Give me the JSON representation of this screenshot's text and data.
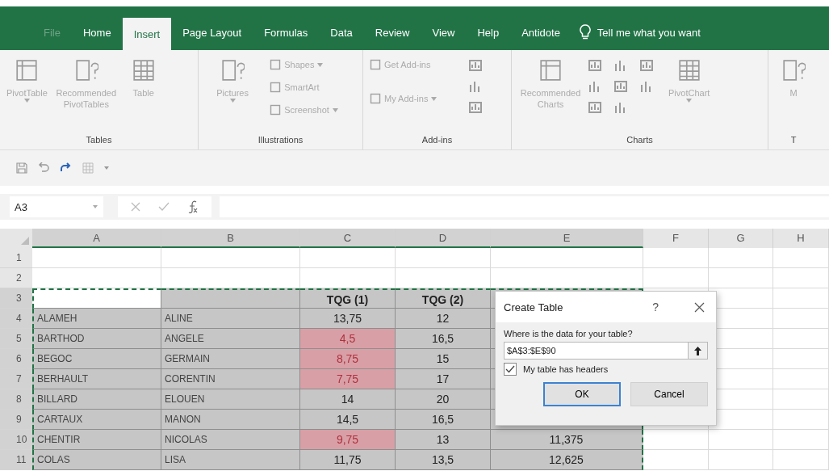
{
  "tabs": [
    {
      "label": "File",
      "selected": false,
      "disabled": true
    },
    {
      "label": "Home",
      "selected": false,
      "disabled": false
    },
    {
      "label": "Insert",
      "selected": true,
      "disabled": false
    },
    {
      "label": "Page Layout",
      "selected": false,
      "disabled": false
    },
    {
      "label": "Formulas",
      "selected": false,
      "disabled": false
    },
    {
      "label": "Data",
      "selected": false,
      "disabled": false
    },
    {
      "label": "Review",
      "selected": false,
      "disabled": false
    },
    {
      "label": "View",
      "selected": false,
      "disabled": false
    },
    {
      "label": "Help",
      "selected": false,
      "disabled": false
    },
    {
      "label": "Antidote",
      "selected": false,
      "disabled": false
    }
  ],
  "tell_me": "Tell me what you want",
  "ribbon": {
    "disabled": true,
    "groups": [
      {
        "label": "Tables",
        "items": [
          {
            "kind": "large",
            "label": "PivotTable",
            "dropdown": true
          },
          {
            "kind": "large",
            "label": "Recommended PivotTables",
            "dropdown": false
          },
          {
            "kind": "large",
            "label": "Table",
            "dropdown": false
          }
        ]
      },
      {
        "label": "Illustrations",
        "items": [
          {
            "kind": "large",
            "label": "Pictures",
            "dropdown": true
          },
          {
            "kind": "small",
            "label": "Shapes",
            "dropdown": true
          },
          {
            "kind": "small",
            "label": "SmartArt",
            "dropdown": false
          },
          {
            "kind": "small",
            "label": "Screenshot",
            "dropdown": true
          }
        ]
      },
      {
        "label": "Add-ins",
        "items": [
          {
            "kind": "small",
            "label": "Get Add-ins",
            "dropdown": false
          },
          {
            "kind": "small",
            "label": "My Add-ins",
            "dropdown": true
          },
          {
            "kind": "icons"
          }
        ]
      },
      {
        "label": "Charts",
        "items": [
          {
            "kind": "large",
            "label": "Recommended Charts",
            "dropdown": false
          },
          {
            "kind": "icons"
          },
          {
            "kind": "large",
            "label": "PivotChart",
            "dropdown": true
          }
        ]
      },
      {
        "label": "T",
        "items": [
          {
            "kind": "large",
            "label": "M",
            "dropdown": false
          }
        ]
      }
    ]
  },
  "name_box": "A3",
  "columns": [
    "A",
    "B",
    "C",
    "D",
    "E",
    "F",
    "G",
    "H"
  ],
  "rows": [
    {
      "number": "1",
      "kind": "empty",
      "cells": []
    },
    {
      "number": "2",
      "kind": "empty",
      "cells": []
    },
    {
      "number": "3",
      "kind": "header",
      "cells": [
        {
          "flagged": false
        },
        {
          "flagged": false
        },
        {
          "text": "TQG (1)",
          "flagged": false
        },
        {
          "text": "TQG (2)",
          "flagged": false
        }
      ]
    },
    {
      "number": "4",
      "kind": "data",
      "cells": [
        {
          "text": "ALAMEH",
          "flagged": false
        },
        {
          "text": "ALINE",
          "flagged": false
        },
        {
          "text": "13,75",
          "flagged": false
        },
        {
          "text": "12",
          "flagged": false
        }
      ]
    },
    {
      "number": "5",
      "kind": "data",
      "cells": [
        {
          "text": "BARTHOD",
          "flagged": false
        },
        {
          "text": "ANGELE",
          "flagged": false
        },
        {
          "text": "4,5",
          "flagged": true
        },
        {
          "text": "16,5",
          "flagged": false
        }
      ]
    },
    {
      "number": "6",
      "kind": "data",
      "cells": [
        {
          "text": "BEGOC",
          "flagged": false
        },
        {
          "text": "GERMAIN",
          "flagged": false
        },
        {
          "text": "8,75",
          "flagged": true
        },
        {
          "text": "15",
          "flagged": false
        }
      ]
    },
    {
      "number": "7",
      "kind": "data",
      "cells": [
        {
          "text": "BERHAULT",
          "flagged": false
        },
        {
          "text": "CORENTIN",
          "flagged": false
        },
        {
          "text": "7,75",
          "flagged": true
        },
        {
          "text": "17",
          "flagged": false
        }
      ]
    },
    {
      "number": "8",
      "kind": "data",
      "cells": [
        {
          "text": "BILLARD",
          "flagged": false
        },
        {
          "text": "ELOUEN",
          "flagged": false
        },
        {
          "text": "14",
          "flagged": false
        },
        {
          "text": "20",
          "flagged": false
        }
      ]
    },
    {
      "number": "9",
      "kind": "data",
      "cells": [
        {
          "text": "CARTAUX",
          "flagged": false
        },
        {
          "text": "MANON",
          "flagged": false
        },
        {
          "text": "14,5",
          "flagged": false
        },
        {
          "text": "16,5",
          "flagged": false
        }
      ]
    },
    {
      "number": "10",
      "kind": "data",
      "cells": [
        {
          "text": "CHENTIR",
          "flagged": false
        },
        {
          "text": "NICOLAS",
          "flagged": false
        },
        {
          "text": "9,75",
          "flagged": true
        },
        {
          "text": "13",
          "flagged": false
        },
        {
          "text": "11,375",
          "flagged": false
        }
      ]
    },
    {
      "number": "11",
      "kind": "data",
      "cells": [
        {
          "text": "COLAS",
          "flagged": false
        },
        {
          "text": "LISA",
          "flagged": false
        },
        {
          "text": "11,75",
          "flagged": false
        },
        {
          "text": "13,5",
          "flagged": false
        },
        {
          "text": "12,625",
          "flagged": false
        }
      ]
    }
  ],
  "dialog": {
    "title": "Create Table",
    "help": "?",
    "prompt": "Where is the data for your table?",
    "range": "$A$3:$E$90",
    "headers_label": "My table has headers",
    "headers_checked": true,
    "buttons": [
      {
        "label": "OK",
        "default": true
      },
      {
        "label": "Cancel",
        "default": false
      }
    ]
  }
}
